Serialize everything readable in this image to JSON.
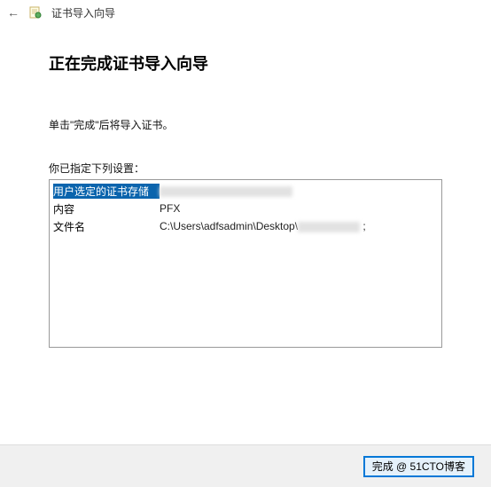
{
  "window": {
    "title": "证书导入向导"
  },
  "page": {
    "heading": "正在完成证书导入向导",
    "instruction": "单击\"完成\"后将导入证书。",
    "settings_label": "你已指定下列设置：",
    "rows": [
      {
        "key": "用户选定的证书存储",
        "value": ""
      },
      {
        "key": "内容",
        "value": "PFX"
      },
      {
        "key": "文件名",
        "value": "C:\\Users\\adfsadmin\\Desktop\\"
      }
    ]
  },
  "footer": {
    "finish_label": "完成 @ 51CTO博客"
  }
}
